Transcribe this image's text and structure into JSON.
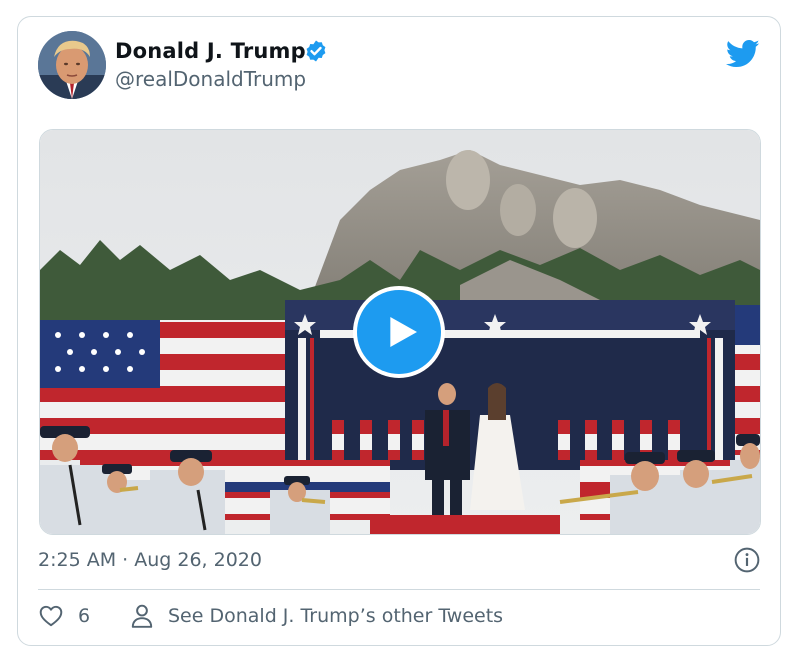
{
  "author": {
    "name": "Donald J. Trump",
    "handle": "@realDonaldTrump",
    "verified": true
  },
  "timestamp": "2:25 AM · Aug 26, 2020",
  "media": {
    "type": "video",
    "play_icon": "play-icon"
  },
  "actions": {
    "like_count": "6",
    "other_tweets_label": "See Donald J. Trump’s other Tweets"
  },
  "colors": {
    "brand_blue": "#1d9bf0",
    "secondary_text": "#536471",
    "border": "#cfd9de"
  }
}
